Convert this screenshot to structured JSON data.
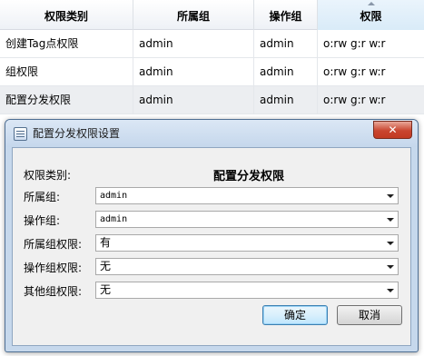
{
  "table": {
    "columns": [
      "权限类别",
      "所属组",
      "操作组",
      "权限"
    ],
    "rows": [
      {
        "category": "创建Tag点权限",
        "group": "admin",
        "op_group": "admin",
        "permission": "o:rw  g:r w:r"
      },
      {
        "category": "组权限",
        "group": "admin",
        "op_group": "admin",
        "permission": "o:rw  g:r w:r"
      },
      {
        "category": "配置分发权限",
        "group": "admin",
        "op_group": "admin",
        "permission": "o:rw  g:r w:r"
      }
    ]
  },
  "dialog": {
    "title": "配置分发权限设置",
    "close_label": "✕",
    "form": {
      "category_label": "权限类别:",
      "category_value": "配置分发权限",
      "group_label": "所属组:",
      "group_value": "admin",
      "op_group_label": "操作组:",
      "op_group_value": "admin",
      "group_perm_label": "所属组权限:",
      "group_perm_value": "有",
      "op_perm_label": "操作组权限:",
      "op_perm_value": "无",
      "other_perm_label": "其他组权限:",
      "other_perm_value": "无"
    },
    "ok_label": "确定",
    "cancel_label": "取消"
  },
  "colors": {
    "selected_row": "#eceef1",
    "dialog_frame": "#c6d8ec",
    "close_button": "#c9452f",
    "default_button": "#bee6fd"
  },
  "icons": {
    "app": "window-app-icon",
    "close": "close-icon",
    "dropdown": "chevron-down-icon",
    "sort": "sort-up-icon"
  }
}
